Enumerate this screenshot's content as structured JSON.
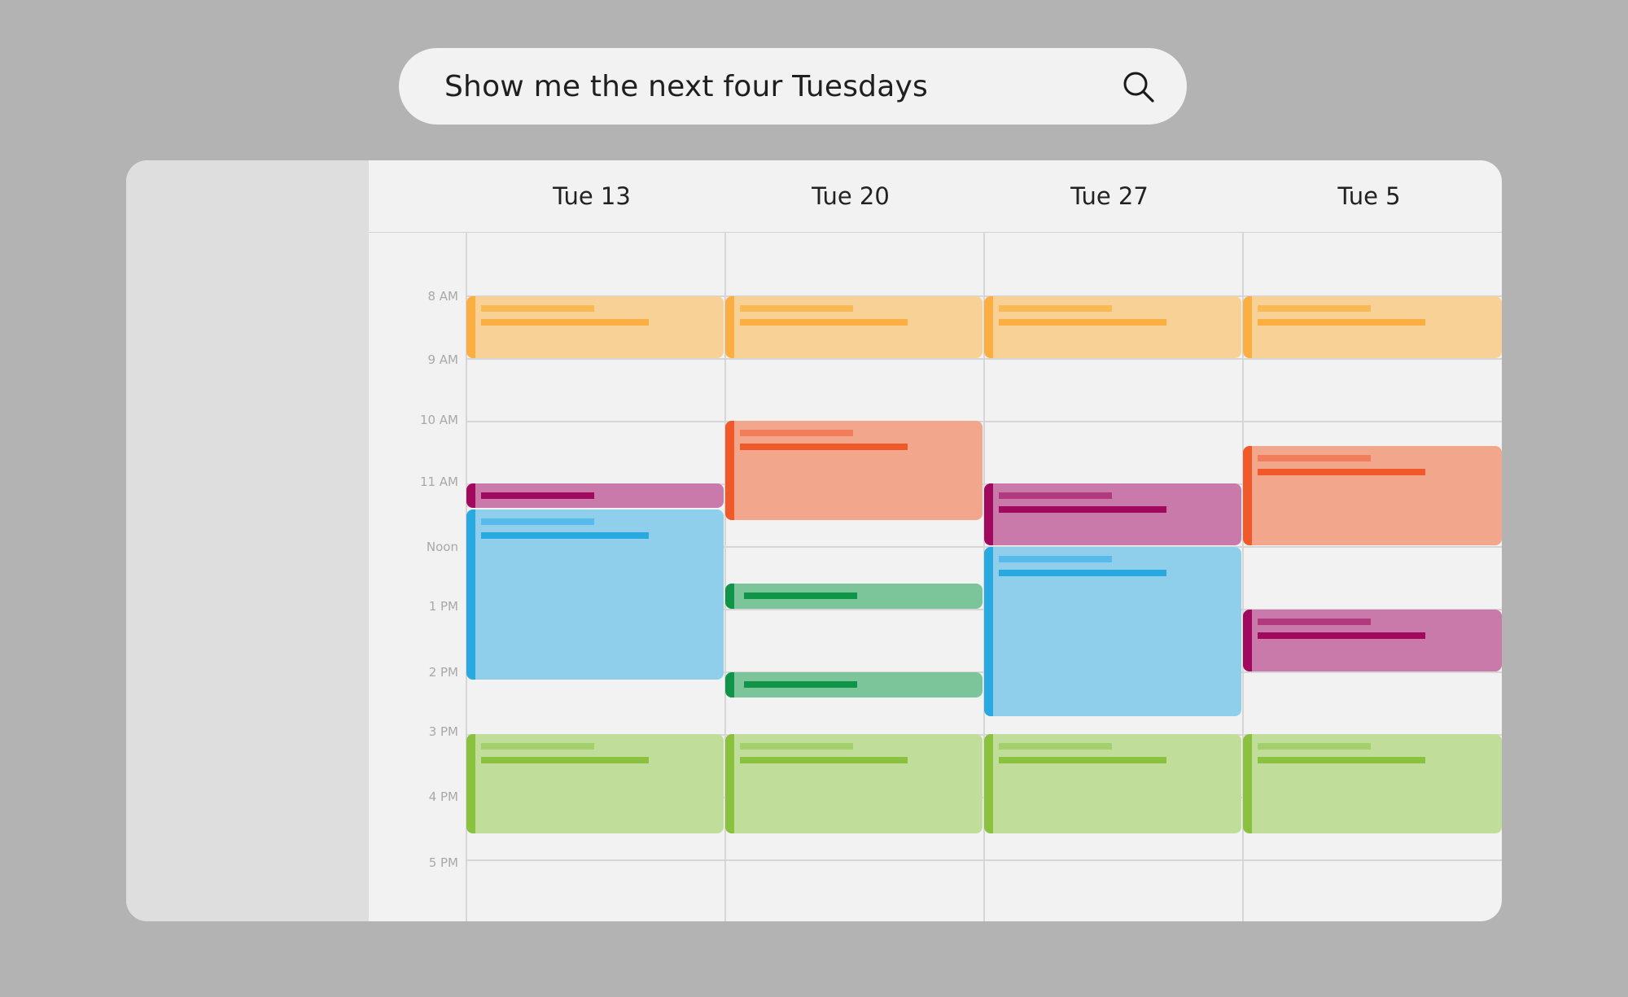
{
  "search": {
    "query": "Show me the next four Tuesdays"
  },
  "calendar": {
    "days": [
      "Tue 13",
      "Tue 20",
      "Tue 27",
      "Tue 5"
    ],
    "times": [
      "8 AM",
      "9 AM",
      "10 AM",
      "11 AM",
      "Noon",
      "1 PM",
      "2 PM",
      "3 PM",
      "4 PM",
      "5 PM"
    ]
  },
  "colors": {
    "background": "#b3b3b3",
    "panel": "#f2f2f2",
    "sidebar": "#dedede",
    "orange_fill": "#f8d197",
    "orange_accent": "#fbae42",
    "coral_fill": "#f2a68c",
    "coral_accent": "#f05a2b",
    "purple_fill": "#c97aaa",
    "purple_accent": "#a0095e",
    "blue_fill": "#8fcfec",
    "blue_accent": "#2aa8e0",
    "green_fill": "#7cc49a",
    "green_accent": "#0f9448",
    "lime_fill": "#c0de99",
    "lime_accent": "#8ac240"
  }
}
